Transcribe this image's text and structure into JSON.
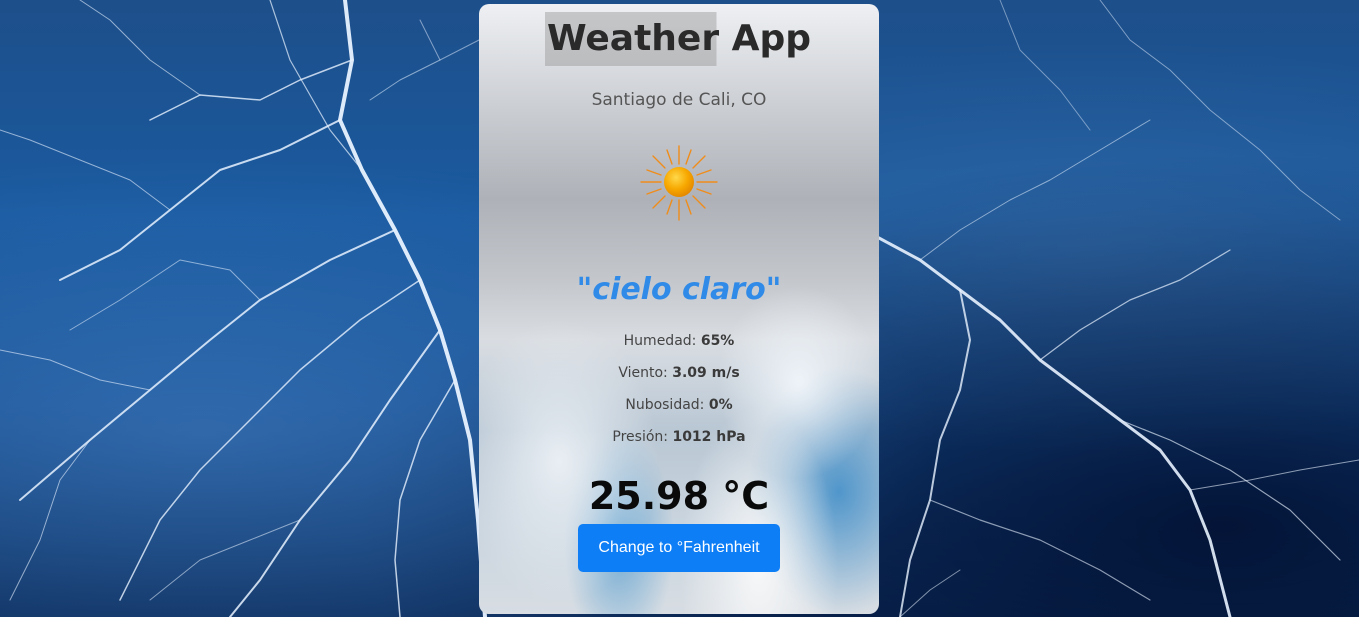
{
  "app": {
    "title": "Weather App"
  },
  "location": {
    "city": "Santiago de Cali, CO"
  },
  "weather": {
    "icon": "sun-icon",
    "description": "\"cielo claro\"",
    "details": [
      {
        "label": "Humedad: ",
        "value": "65%"
      },
      {
        "label": "Viento: ",
        "value": "3.09 m/s"
      },
      {
        "label": "Nubosidad: ",
        "value": "0%"
      },
      {
        "label": "Presión: ",
        "value": "1012 hPa"
      }
    ],
    "temperature": "25.98 °C"
  },
  "controls": {
    "unit_toggle_label": "Change to °Fahrenheit"
  },
  "colors": {
    "accent_button": "#0d7ef6",
    "description_text": "#2f8ae8",
    "sun": "#f5a000"
  }
}
